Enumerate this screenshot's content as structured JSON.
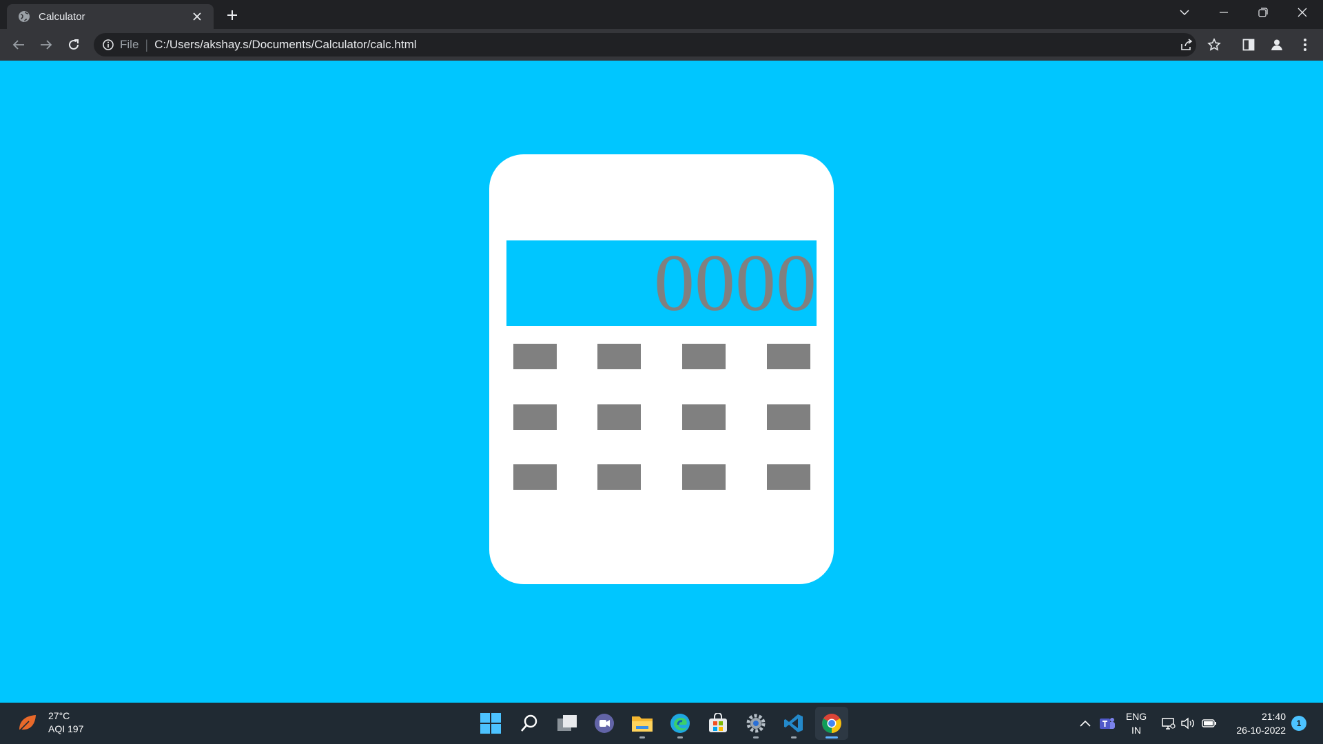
{
  "browser": {
    "tab_title": "Calculator",
    "address_scheme": "File",
    "address_url": "C:/Users/akshay.s/Documents/Calculator/calc.html"
  },
  "page": {
    "background_color": "#00c6ff",
    "calculator": {
      "body_color": "#ffffff",
      "display_value": "0000",
      "display_background": "#00c6ff",
      "key_color": "#808080",
      "key_rows": 3,
      "key_columns": 4
    }
  },
  "taskbar": {
    "weather_temp": "27°C",
    "weather_aqi": "AQI 197",
    "pinned_apps": [
      "start-icon",
      "search-icon",
      "task-view-icon",
      "teams-chat-icon",
      "file-explorer-icon",
      "edge-icon",
      "store-icon",
      "settings-icon",
      "vscode-icon",
      "chrome-icon"
    ],
    "language_top": "ENG",
    "language_bottom": "IN",
    "time": "21:40",
    "date": "26-10-2022",
    "notification_count": "1"
  }
}
